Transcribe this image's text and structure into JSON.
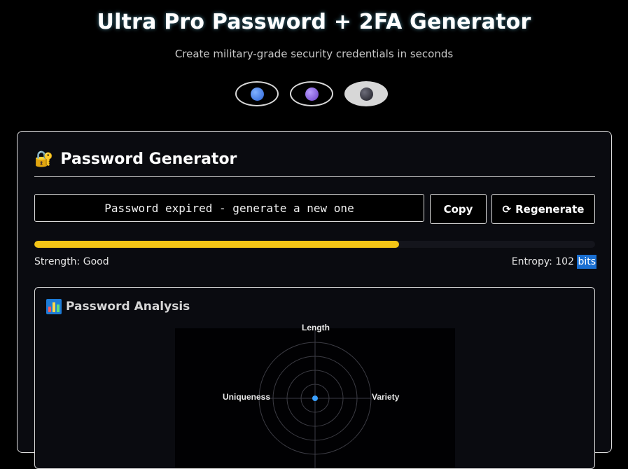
{
  "header": {
    "title": "Ultra Pro Password + 2FA Generator",
    "subtitle": "Create military-grade security credentials in seconds"
  },
  "themes": [
    {
      "name": "blue",
      "color": "#2c64d6",
      "active": false
    },
    {
      "name": "purple",
      "color": "#6a3fc7",
      "active": false
    },
    {
      "name": "dark",
      "color": "#1b1b22",
      "active": true
    }
  ],
  "generator": {
    "heading_emoji": "🔐",
    "heading": "Password Generator",
    "password_value": "Password expired - generate a new one",
    "copy_label": "Copy",
    "regenerate_icon": "⟳",
    "regenerate_label": "Regenerate",
    "strength_percent": 65,
    "strength_color": "#f3c416",
    "strength_text": "Strength: Good",
    "entropy_text": "Entropy: 102",
    "entropy_unit": "bits"
  },
  "analysis": {
    "heading": "Password Analysis",
    "icon": "bar-chart-icon",
    "radar_axes": [
      "Length",
      "Variety",
      "Uniqueness"
    ],
    "point_color": "#3aa0ff"
  }
}
